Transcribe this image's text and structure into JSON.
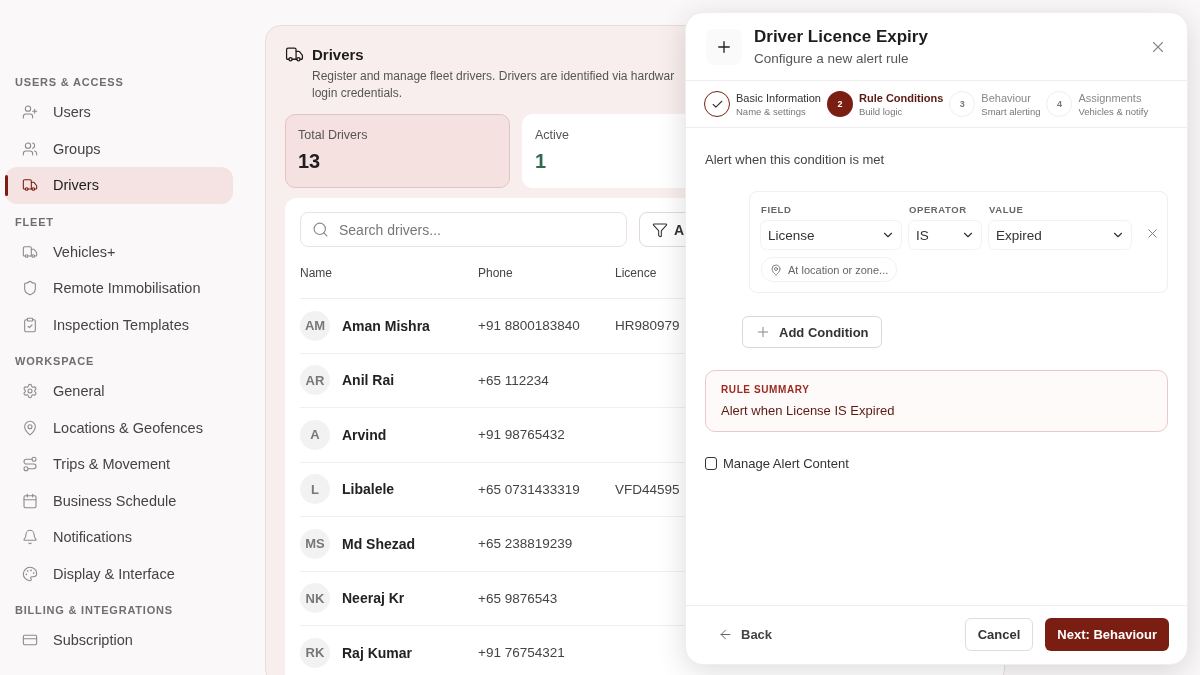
{
  "sidebar": {
    "sections": [
      {
        "title": "USERS & ACCESS",
        "items": [
          {
            "label": "Users",
            "selected": false
          },
          {
            "label": "Groups",
            "selected": false
          },
          {
            "label": "Drivers",
            "selected": true
          }
        ]
      },
      {
        "title": "FLEET",
        "items": [
          {
            "label": "Vehicles+",
            "selected": false
          },
          {
            "label": "Remote Immobilisation",
            "selected": false
          },
          {
            "label": "Inspection Templates",
            "selected": false
          }
        ]
      },
      {
        "title": "WORKSPACE",
        "items": [
          {
            "label": "General",
            "selected": false
          },
          {
            "label": "Locations & Geofences",
            "selected": false
          },
          {
            "label": "Trips & Movement",
            "selected": false
          },
          {
            "label": "Business Schedule",
            "selected": false
          },
          {
            "label": "Notifications",
            "selected": false
          },
          {
            "label": "Display & Interface",
            "selected": false
          }
        ]
      },
      {
        "title": "BILLING & INTEGRATIONS",
        "items": [
          {
            "label": "Subscription",
            "selected": false
          }
        ]
      }
    ]
  },
  "page": {
    "title": "Drivers",
    "description": [
      "Register and manage fleet drivers. Drivers are identified via hardwar",
      "login credentials."
    ],
    "stats": [
      {
        "label": "Total Drivers",
        "value": "13",
        "selected": true,
        "color": "#1f1f1f"
      },
      {
        "label": "Active",
        "value": "1",
        "selected": false,
        "color": "#2f6b4f"
      }
    ],
    "search": {
      "placeholder": "Search drivers..."
    },
    "filter_button": "A",
    "table": {
      "columns": [
        "Name",
        "Phone",
        "Licence"
      ],
      "rows": [
        {
          "initials": "AM",
          "name": "Aman Mishra",
          "phone": "+91 8800183840",
          "licence": "HR980979"
        },
        {
          "initials": "AR",
          "name": "Anil Rai",
          "phone": "+65 112234"
        },
        {
          "initials": "A",
          "name": "Arvind",
          "phone": "+91 98765432"
        },
        {
          "initials": "L",
          "name": "Libalele",
          "phone": "+65 0731433319",
          "licence": "VFD44595"
        },
        {
          "initials": "MS",
          "name": "Md Shezad",
          "phone": "+65 238819239"
        },
        {
          "initials": "NK",
          "name": "Neeraj Kr",
          "phone": "+65 9876543"
        },
        {
          "initials": "RK",
          "name": "Raj Kumar",
          "phone": "+91 76754321"
        }
      ]
    }
  },
  "modal": {
    "title": "Driver Licence Expiry",
    "subtitle": "Configure a new alert rule",
    "steps": [
      {
        "label": "Basic Information",
        "sublabel": "Name & settings",
        "completed": true,
        "selected": false
      },
      {
        "number": "2",
        "label": "Rule Conditions",
        "sublabel": "Build logic",
        "completed": false,
        "selected": true
      },
      {
        "number": "3",
        "label": "Behaviour",
        "sublabel": "Smart alerting",
        "completed": false,
        "selected": false
      },
      {
        "number": "4",
        "label": "Assignments",
        "sublabel": "Vehicles & notify",
        "completed": false,
        "selected": false
      }
    ],
    "prompt": "Alert when this condition is met",
    "condition": {
      "field_label": "FIELD",
      "field_value": "License",
      "operator_label": "OPERATOR",
      "operator_value": "IS",
      "value_label": "VALUE",
      "value_value": "Expired",
      "location_placeholder": "At location or zone..."
    },
    "add_condition": "Add Condition",
    "summary": {
      "title": "RULE SUMMARY",
      "text": "Alert when License IS Expired"
    },
    "manage_content": {
      "label": "Manage Alert Content",
      "checked": false
    },
    "back": "Back",
    "cancel": "Cancel",
    "next": "Next: Behaviour"
  }
}
